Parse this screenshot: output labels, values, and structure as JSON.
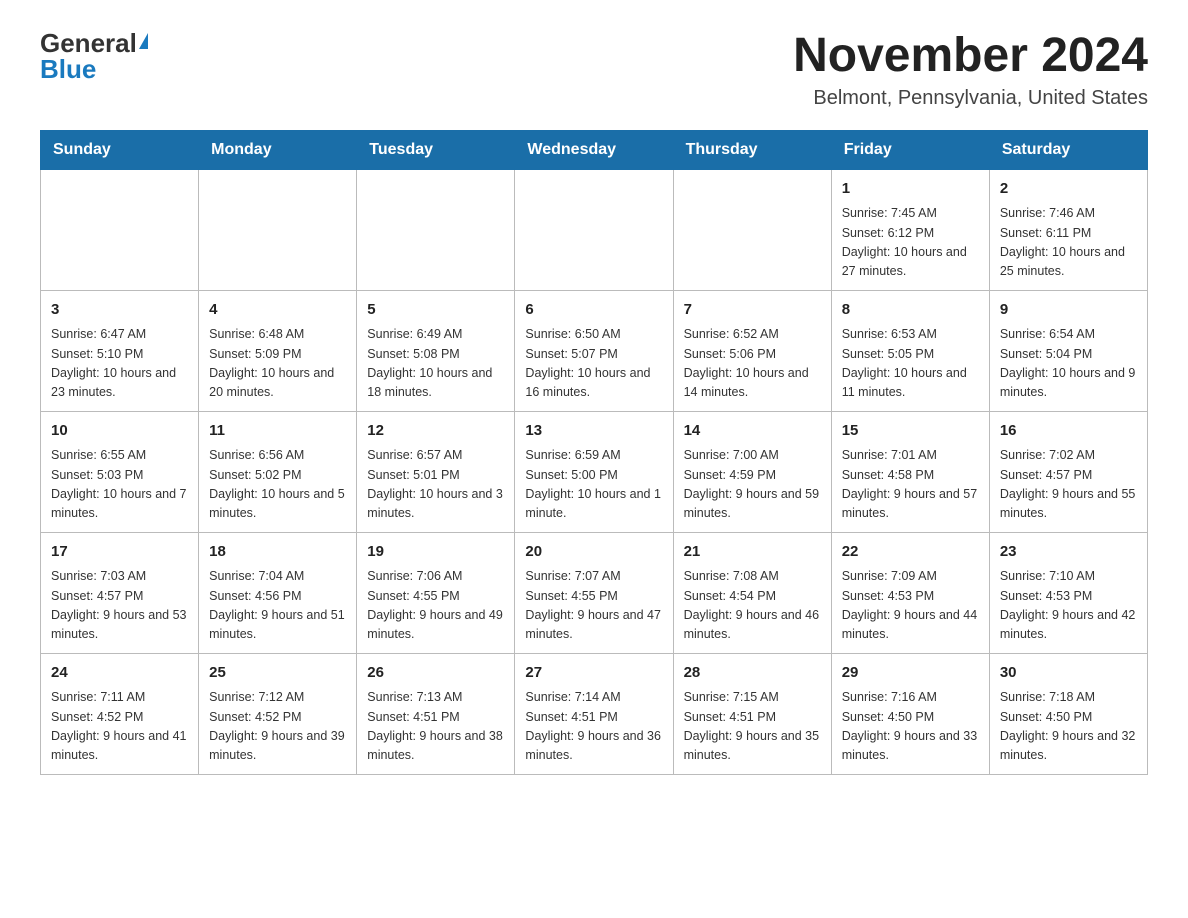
{
  "header": {
    "logo_general": "General",
    "logo_blue": "Blue",
    "month_title": "November 2024",
    "location": "Belmont, Pennsylvania, United States"
  },
  "weekdays": [
    "Sunday",
    "Monday",
    "Tuesday",
    "Wednesday",
    "Thursday",
    "Friday",
    "Saturday"
  ],
  "rows": [
    [
      {
        "day": "",
        "info": ""
      },
      {
        "day": "",
        "info": ""
      },
      {
        "day": "",
        "info": ""
      },
      {
        "day": "",
        "info": ""
      },
      {
        "day": "",
        "info": ""
      },
      {
        "day": "1",
        "info": "Sunrise: 7:45 AM\nSunset: 6:12 PM\nDaylight: 10 hours and 27 minutes."
      },
      {
        "day": "2",
        "info": "Sunrise: 7:46 AM\nSunset: 6:11 PM\nDaylight: 10 hours and 25 minutes."
      }
    ],
    [
      {
        "day": "3",
        "info": "Sunrise: 6:47 AM\nSunset: 5:10 PM\nDaylight: 10 hours and 23 minutes."
      },
      {
        "day": "4",
        "info": "Sunrise: 6:48 AM\nSunset: 5:09 PM\nDaylight: 10 hours and 20 minutes."
      },
      {
        "day": "5",
        "info": "Sunrise: 6:49 AM\nSunset: 5:08 PM\nDaylight: 10 hours and 18 minutes."
      },
      {
        "day": "6",
        "info": "Sunrise: 6:50 AM\nSunset: 5:07 PM\nDaylight: 10 hours and 16 minutes."
      },
      {
        "day": "7",
        "info": "Sunrise: 6:52 AM\nSunset: 5:06 PM\nDaylight: 10 hours and 14 minutes."
      },
      {
        "day": "8",
        "info": "Sunrise: 6:53 AM\nSunset: 5:05 PM\nDaylight: 10 hours and 11 minutes."
      },
      {
        "day": "9",
        "info": "Sunrise: 6:54 AM\nSunset: 5:04 PM\nDaylight: 10 hours and 9 minutes."
      }
    ],
    [
      {
        "day": "10",
        "info": "Sunrise: 6:55 AM\nSunset: 5:03 PM\nDaylight: 10 hours and 7 minutes."
      },
      {
        "day": "11",
        "info": "Sunrise: 6:56 AM\nSunset: 5:02 PM\nDaylight: 10 hours and 5 minutes."
      },
      {
        "day": "12",
        "info": "Sunrise: 6:57 AM\nSunset: 5:01 PM\nDaylight: 10 hours and 3 minutes."
      },
      {
        "day": "13",
        "info": "Sunrise: 6:59 AM\nSunset: 5:00 PM\nDaylight: 10 hours and 1 minute."
      },
      {
        "day": "14",
        "info": "Sunrise: 7:00 AM\nSunset: 4:59 PM\nDaylight: 9 hours and 59 minutes."
      },
      {
        "day": "15",
        "info": "Sunrise: 7:01 AM\nSunset: 4:58 PM\nDaylight: 9 hours and 57 minutes."
      },
      {
        "day": "16",
        "info": "Sunrise: 7:02 AM\nSunset: 4:57 PM\nDaylight: 9 hours and 55 minutes."
      }
    ],
    [
      {
        "day": "17",
        "info": "Sunrise: 7:03 AM\nSunset: 4:57 PM\nDaylight: 9 hours and 53 minutes."
      },
      {
        "day": "18",
        "info": "Sunrise: 7:04 AM\nSunset: 4:56 PM\nDaylight: 9 hours and 51 minutes."
      },
      {
        "day": "19",
        "info": "Sunrise: 7:06 AM\nSunset: 4:55 PM\nDaylight: 9 hours and 49 minutes."
      },
      {
        "day": "20",
        "info": "Sunrise: 7:07 AM\nSunset: 4:55 PM\nDaylight: 9 hours and 47 minutes."
      },
      {
        "day": "21",
        "info": "Sunrise: 7:08 AM\nSunset: 4:54 PM\nDaylight: 9 hours and 46 minutes."
      },
      {
        "day": "22",
        "info": "Sunrise: 7:09 AM\nSunset: 4:53 PM\nDaylight: 9 hours and 44 minutes."
      },
      {
        "day": "23",
        "info": "Sunrise: 7:10 AM\nSunset: 4:53 PM\nDaylight: 9 hours and 42 minutes."
      }
    ],
    [
      {
        "day": "24",
        "info": "Sunrise: 7:11 AM\nSunset: 4:52 PM\nDaylight: 9 hours and 41 minutes."
      },
      {
        "day": "25",
        "info": "Sunrise: 7:12 AM\nSunset: 4:52 PM\nDaylight: 9 hours and 39 minutes."
      },
      {
        "day": "26",
        "info": "Sunrise: 7:13 AM\nSunset: 4:51 PM\nDaylight: 9 hours and 38 minutes."
      },
      {
        "day": "27",
        "info": "Sunrise: 7:14 AM\nSunset: 4:51 PM\nDaylight: 9 hours and 36 minutes."
      },
      {
        "day": "28",
        "info": "Sunrise: 7:15 AM\nSunset: 4:51 PM\nDaylight: 9 hours and 35 minutes."
      },
      {
        "day": "29",
        "info": "Sunrise: 7:16 AM\nSunset: 4:50 PM\nDaylight: 9 hours and 33 minutes."
      },
      {
        "day": "30",
        "info": "Sunrise: 7:18 AM\nSunset: 4:50 PM\nDaylight: 9 hours and 32 minutes."
      }
    ]
  ]
}
